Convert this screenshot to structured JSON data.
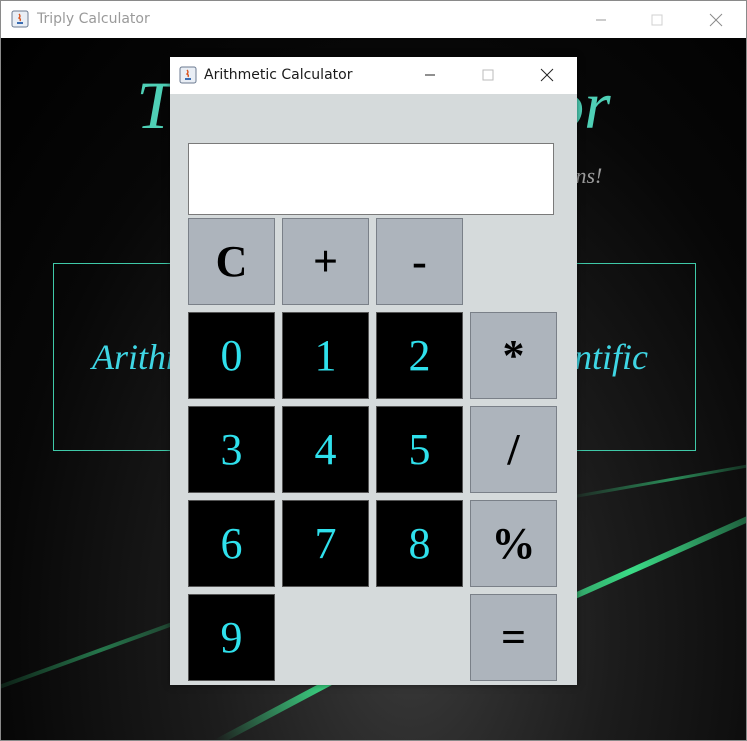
{
  "outer_window": {
    "title": "Triply Calculator",
    "heading": "Triply Calculator",
    "subtitle": "...ns!",
    "mode_left": "Arithmetic",
    "mode_right": "Scientific"
  },
  "dialog": {
    "title": "Arithmetic Calculator",
    "display_value": "",
    "keys": {
      "clear": "C",
      "plus": "+",
      "minus": "-",
      "multiply": "*",
      "divide": "/",
      "modulo": "%",
      "equals": "=",
      "d0": "0",
      "d1": "1",
      "d2": "2",
      "d3": "3",
      "d4": "4",
      "d5": "5",
      "d6": "6",
      "d7": "7",
      "d8": "8",
      "d9": "9"
    }
  },
  "colors": {
    "accent_teal": "#4fd0b6",
    "digit_cyan": "#2fe0ec",
    "operator_bg": "#adb4bc",
    "digit_bg": "#000000",
    "dialog_bg": "#d5dadb"
  },
  "icons": [
    "java-app-icon",
    "minimize-icon",
    "maximize-icon",
    "close-icon"
  ]
}
